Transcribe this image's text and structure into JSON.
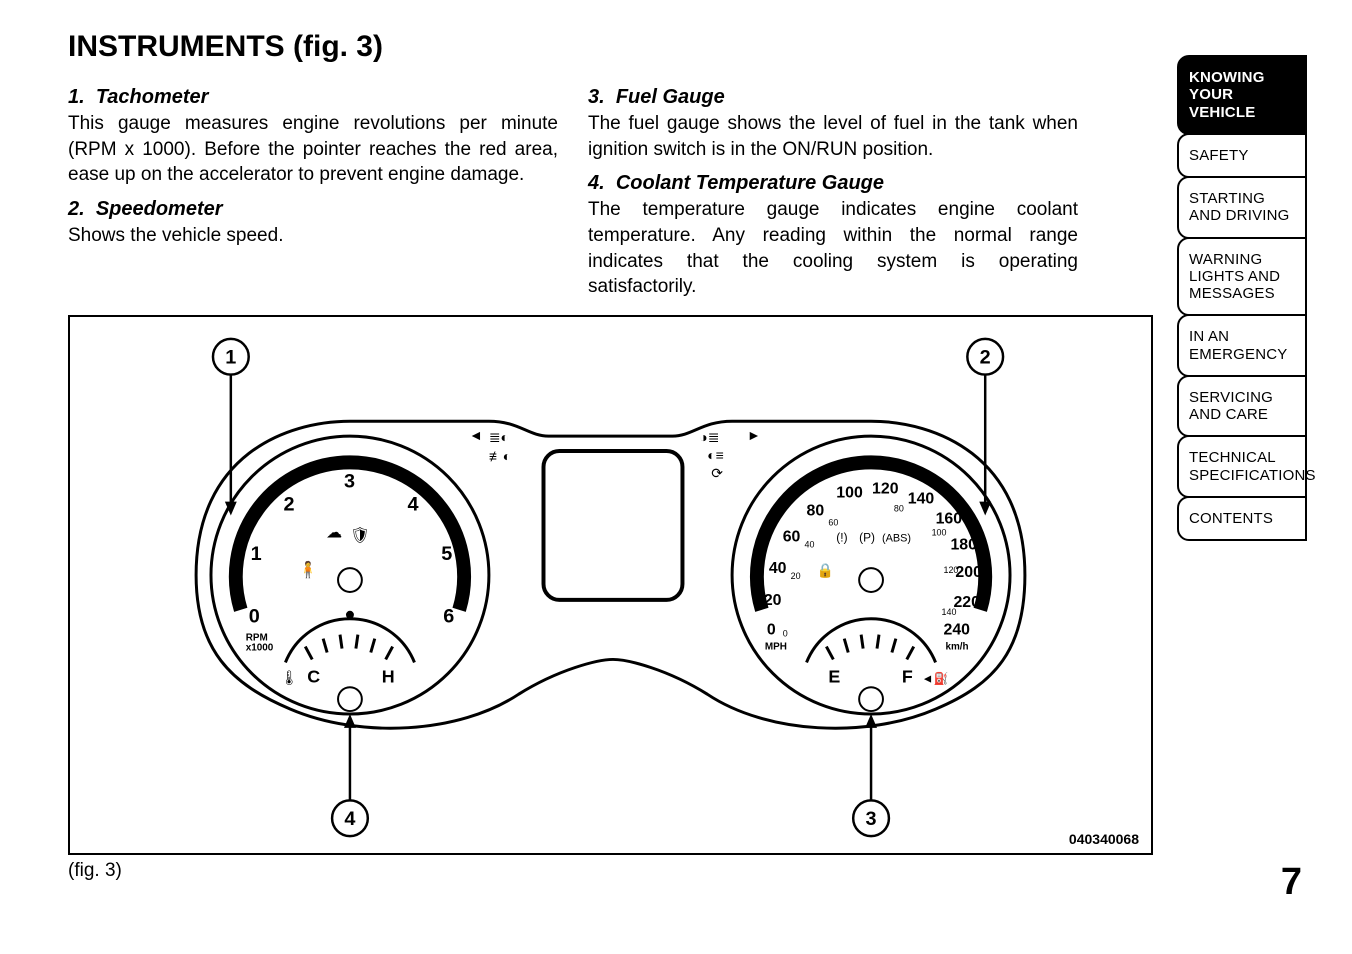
{
  "heading": "INSTRUMENTS (fig.  3)",
  "items": [
    {
      "num": "1.",
      "title": "Tachometer",
      "body": "This gauge measures engine revolutions per minute (RPM x 1000). Before the pointer reaches the red area, ease up on the accelerator to prevent engine damage."
    },
    {
      "num": "2.",
      "title": "Speedometer",
      "body": "Shows the vehicle speed."
    },
    {
      "num": "3.",
      "title": "Fuel Gauge",
      "body": "The fuel gauge shows the level of fuel in the tank when ignition switch is in the ON/RUN position."
    },
    {
      "num": "4.",
      "title": "Coolant Temperature Gauge",
      "body": "The temperature gauge indicates engine coolant temperature. Any reading within the normal range indicates that the cooling system is operating satisfactorily."
    }
  ],
  "figure_caption": "(fig. 3)",
  "figure_code": "040340068",
  "page_number": "7",
  "tabs": [
    "KNOWING YOUR VEHICLE",
    "SAFETY",
    "STARTING AND DRIVING",
    "WARNING LIGHTS AND MESSAGES",
    "IN AN EMERGENCY",
    "SERVICING AND CARE",
    "TECHNICAL SPECIFICATIONS",
    "CONTENTS"
  ],
  "active_tab_index": 0,
  "callouts": {
    "c1": "1",
    "c2": "2",
    "c3": "3",
    "c4": "4"
  },
  "tachometer": {
    "label": "RPM x1000",
    "ticks": [
      "0",
      "1",
      "2",
      "3",
      "4",
      "5",
      "6"
    ],
    "sub_gauge": {
      "left": "C",
      "right": "H"
    }
  },
  "speedometer": {
    "label_left": "MPH",
    "label_right": "km/h",
    "outer_ticks": [
      "0",
      "20",
      "40",
      "60",
      "80",
      "100",
      "120",
      "140",
      "160",
      "180",
      "200",
      "220",
      "240"
    ],
    "inner_ticks": [
      "0",
      "",
      "20",
      "40",
      "60",
      "80",
      "",
      "100",
      "",
      "120",
      "",
      "140",
      ""
    ],
    "sub_gauge": {
      "left": "E",
      "right": "F"
    }
  },
  "icons_row_left": [
    "headlamp-icon",
    "foglamp-icon"
  ],
  "icons_row_right": [
    "rear-fog-icon",
    "high-beam-icon",
    "cruise-icon"
  ],
  "warning_icons_left": [
    "engine-icon",
    "seatbelt-icon",
    "airbag-icon"
  ],
  "warning_icons_right": [
    "brake-icon",
    "parking-icon",
    "abs-icon",
    "immobilizer-icon"
  ]
}
